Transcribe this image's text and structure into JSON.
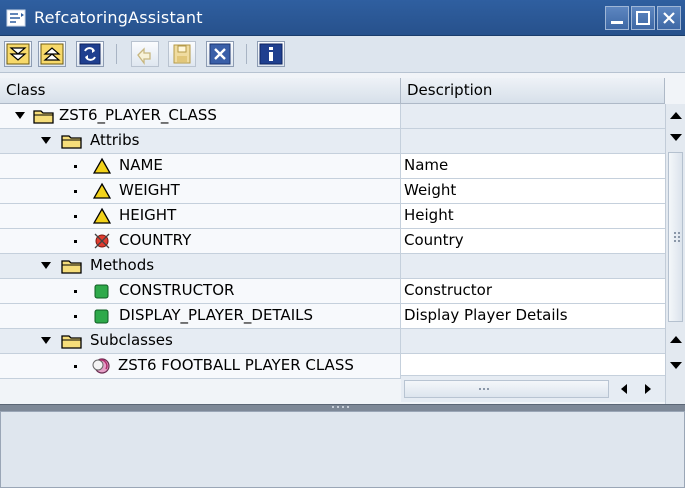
{
  "window": {
    "title": "RefcatoringAssistant",
    "controls": [
      "minimize",
      "maximize",
      "close"
    ]
  },
  "toolbar": {
    "buttons": [
      {
        "icon": "expand-all-icon",
        "enabled": true
      },
      {
        "icon": "collapse-all-icon",
        "enabled": true
      },
      {
        "icon": "refresh-icon",
        "enabled": true
      },
      {
        "icon": "undo-icon",
        "enabled": false
      },
      {
        "icon": "save-icon",
        "enabled": false
      },
      {
        "icon": "cancel-icon",
        "enabled": true
      },
      {
        "icon": "info-icon",
        "enabled": true
      }
    ]
  },
  "columns": {
    "class": "Class",
    "description": "Description"
  },
  "tree": {
    "root": {
      "label": "ZST6_PLAYER_CLASS",
      "description": ""
    },
    "attribs": {
      "label": "Attribs",
      "items": [
        {
          "name": "NAME",
          "description": "Name",
          "status": "warning"
        },
        {
          "name": "WEIGHT",
          "description": "Weight",
          "status": "warning"
        },
        {
          "name": "HEIGHT",
          "description": "Height",
          "status": "warning"
        },
        {
          "name": "COUNTRY",
          "description": "Country",
          "status": "error"
        }
      ]
    },
    "methods": {
      "label": "Methods",
      "items": [
        {
          "name": "CONSTRUCTOR",
          "description": "Constructor",
          "status": "ok"
        },
        {
          "name": "DISPLAY_PLAYER_DETAILS",
          "description": "Display Player Details",
          "status": "ok"
        }
      ]
    },
    "subclasses": {
      "label": "Subclasses",
      "items": [
        {
          "name": "ZST6 FOOTBALL PLAYER CLASS",
          "description": ""
        }
      ]
    }
  },
  "colors": {
    "title_bar": "#2f5fa0",
    "warning": "#f2d21b",
    "error": "#e23b2e",
    "ok": "#2ea94a",
    "folder": "#f5dd7a"
  }
}
